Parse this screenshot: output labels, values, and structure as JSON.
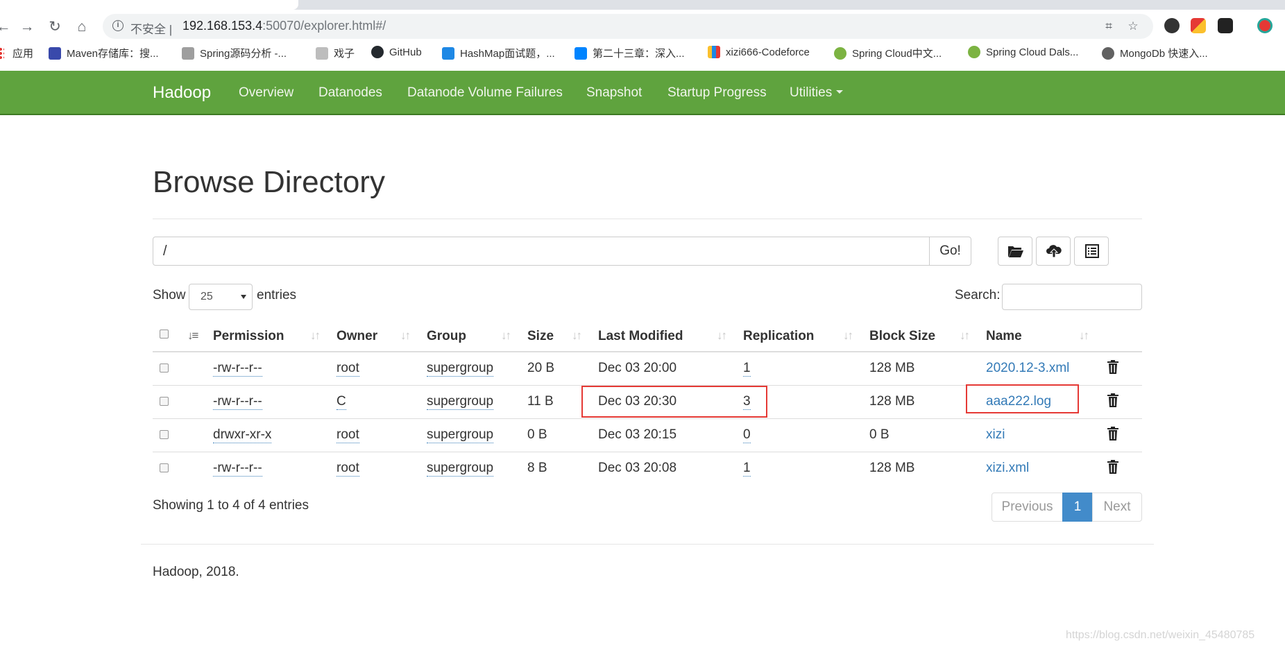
{
  "browser": {
    "insecure_label": "不安全",
    "url_host": "192.168.153.4",
    "url_rest": ":50070/explorer.html#/",
    "bookmarks": [
      {
        "label": "应用"
      },
      {
        "label": "Maven存储库：搜..."
      },
      {
        "label": "Spring源码分析 -..."
      },
      {
        "label": "戏子"
      },
      {
        "label": "GitHub"
      },
      {
        "label": "HashMap面试题，..."
      },
      {
        "label": "第二十三章：深入..."
      },
      {
        "label": "xizi666-Codeforce"
      },
      {
        "label": "Spring Cloud中文..."
      },
      {
        "label": "Spring Cloud Dals..."
      },
      {
        "label": "MongoDb 快速入..."
      }
    ]
  },
  "navbar": {
    "brand": "Hadoop",
    "links": [
      "Overview",
      "Datanodes",
      "Datanode Volume Failures",
      "Snapshot",
      "Startup Progress",
      "Utilities"
    ],
    "color": "#5fa33e"
  },
  "main": {
    "title": "Browse Directory",
    "path_value": "/",
    "go_label": "Go!",
    "show_label": "Show",
    "entries_per_page": "25",
    "entries_label": "entries",
    "search_label": "Search:",
    "columns": [
      "Permission",
      "Owner",
      "Group",
      "Size",
      "Last Modified",
      "Replication",
      "Block Size",
      "Name"
    ],
    "rows": [
      {
        "permission": "-rw-r--r--",
        "owner": "root",
        "group": "supergroup",
        "size": "20 B",
        "modified": "Dec 03 20:00",
        "replication": "1",
        "block_size": "128 MB",
        "name": "2020.12-3.xml"
      },
      {
        "permission": "-rw-r--r--",
        "owner": "C",
        "group": "supergroup",
        "size": "11 B",
        "modified": "Dec 03 20:30",
        "replication": "3",
        "block_size": "128 MB",
        "name": "aaa222.log"
      },
      {
        "permission": "drwxr-xr-x",
        "owner": "root",
        "group": "supergroup",
        "size": "0 B",
        "modified": "Dec 03 20:15",
        "replication": "0",
        "block_size": "0 B",
        "name": "xizi"
      },
      {
        "permission": "-rw-r--r--",
        "owner": "root",
        "group": "supergroup",
        "size": "8 B",
        "modified": "Dec 03 20:08",
        "replication": "1",
        "block_size": "128 MB",
        "name": "xizi.xml"
      }
    ],
    "info": "Showing 1 to 4 of 4 entries",
    "pagination": {
      "previous": "Previous",
      "current": "1",
      "next": "Next"
    }
  },
  "footer": "Hadoop, 2018.",
  "watermark": "https://blog.csdn.net/weixin_45480785",
  "accent": "#337ab7",
  "highlight_color": "#e53935"
}
